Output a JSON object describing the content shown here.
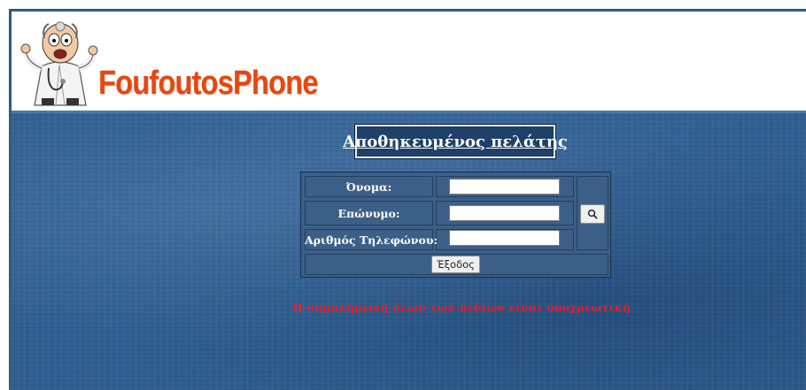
{
  "app": {
    "brand_name": "FoufoutosPhone",
    "brand_color": "#e8470c",
    "logo_icon": "cartoon-doctor-icon"
  },
  "page": {
    "title": "Αποθηκευμένος πελάτης",
    "background_color": "#2f5f92"
  },
  "form": {
    "first_name_label": "Όνομα:",
    "first_name_value": "",
    "last_name_label": "Επώνυμο:",
    "last_name_value": "",
    "phone_label": "Αριθμός Τηλεφώνου:",
    "phone_value": "",
    "search_icon": "search-icon",
    "exit_label": "Έξοδος"
  },
  "messages": {
    "required_notice": "Η συμπλήρωση όλων των πεδίων είναι υποχρεωτική",
    "notice_color": "#e0202a"
  }
}
